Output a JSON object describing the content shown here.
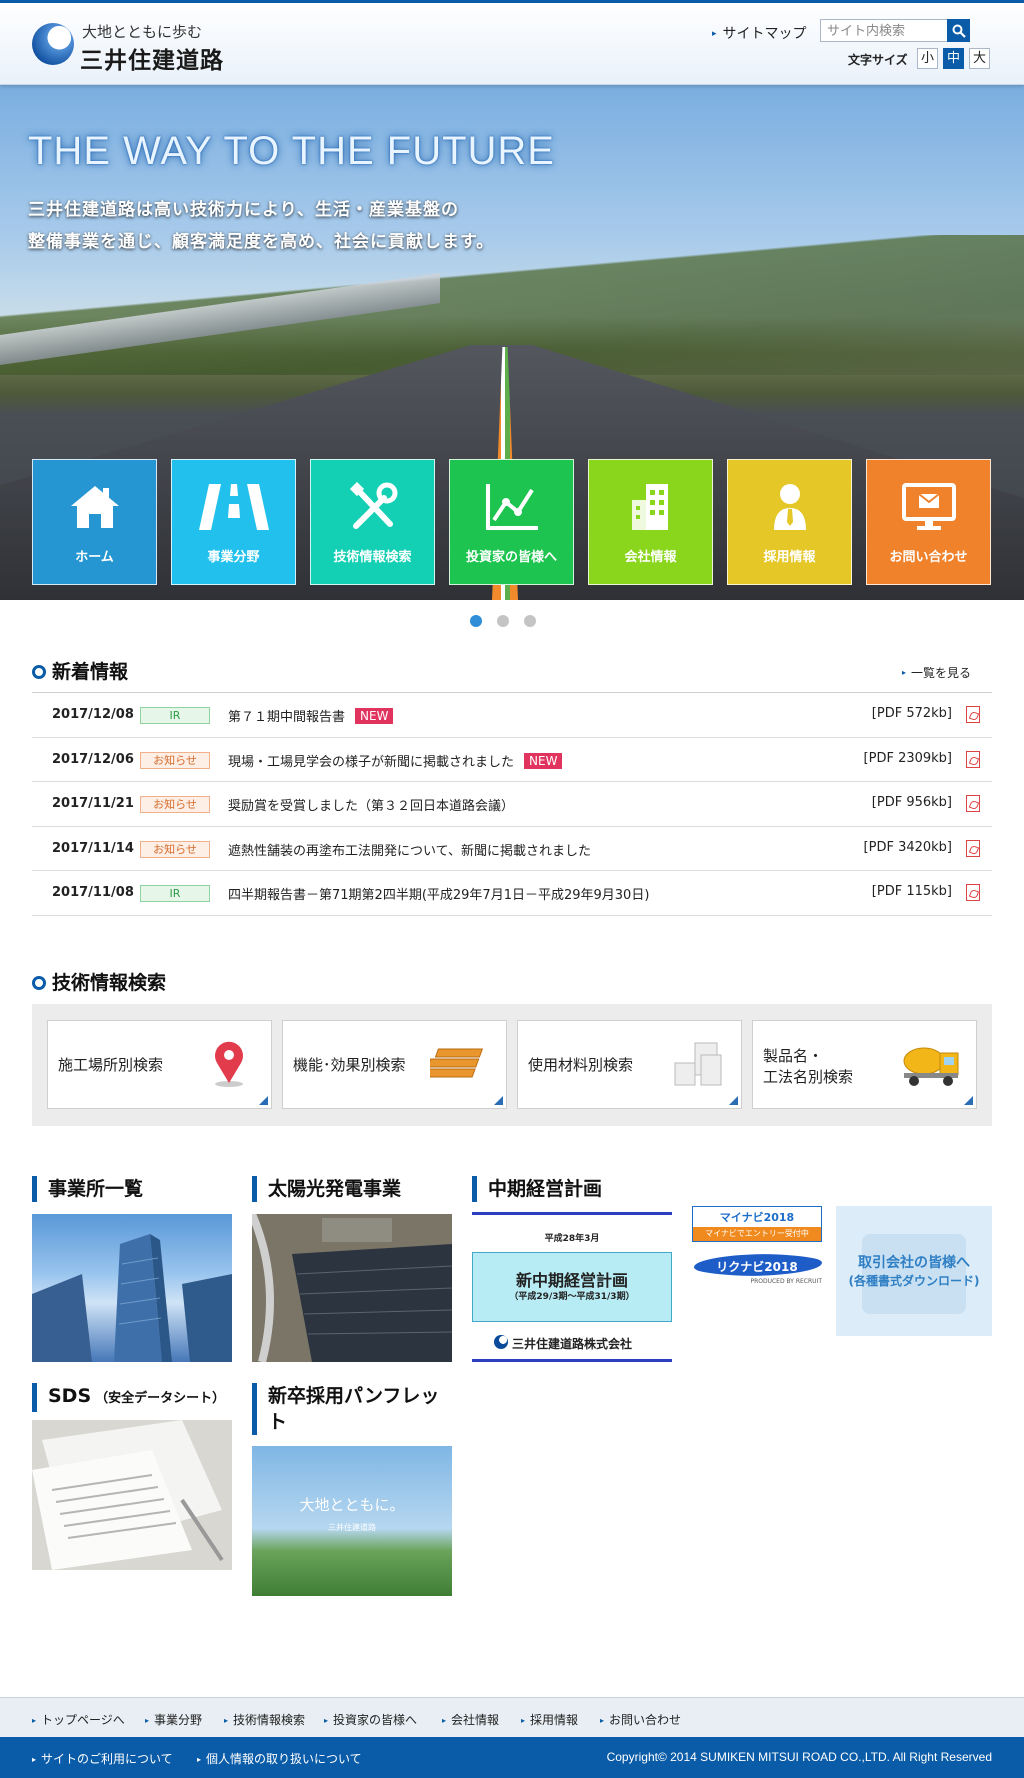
{
  "header": {
    "logo_tagline": "大地とともに歩む",
    "logo_name": "三井住建道路",
    "sitemap_label": "サイトマップ",
    "search_placeholder": "サイト内検索",
    "font_size_label": "文字サイズ",
    "font_sizes": [
      "小",
      "中",
      "大"
    ],
    "font_size_selected": "中"
  },
  "hero": {
    "title": "THE WAY TO THE FUTURE",
    "lines": [
      "三井住建道路は高い技術力により、生活・産業基盤の",
      "整備事業を通じ、顧客満足度を高め、社会に貢献します。"
    ],
    "slides_total": 3,
    "slide_active": 1
  },
  "tiles": [
    {
      "label": "ホーム",
      "icon": "house-icon",
      "color": "#2596d1"
    },
    {
      "label": "事業分野",
      "icon": "road-icon",
      "color": "#22c0ec"
    },
    {
      "label": "技術情報検索",
      "icon": "tools-icon",
      "color": "#13cfb3"
    },
    {
      "label": "投資家の皆様へ",
      "icon": "line-chart-icon",
      "color": "#1dc44f"
    },
    {
      "label": "会社情報",
      "icon": "building-icon",
      "color": "#8ad61c"
    },
    {
      "label": "採用情報",
      "icon": "person-icon",
      "color": "#e5c727"
    },
    {
      "label": "お問い合わせ",
      "icon": "mail-monitor-icon",
      "color": "#f0822c"
    }
  ],
  "news": {
    "heading": "新着情報",
    "more_label": "一覧を見る",
    "items": [
      {
        "date": "2017/12/08",
        "tag": "IR",
        "tag_type": "ir",
        "title": "第７１期中間報告書",
        "is_new": true,
        "new_label": "NEW",
        "size": "[PDF 572kb]"
      },
      {
        "date": "2017/12/06",
        "tag": "お知らせ",
        "tag_type": "info",
        "title": "現場・工場見学会の様子が新聞に掲載されました",
        "is_new": true,
        "new_label": "NEW",
        "size": "[PDF 2309kb]"
      },
      {
        "date": "2017/11/21",
        "tag": "お知らせ",
        "tag_type": "info",
        "title": "奨励賞を受賞しました（第３２回日本道路会議）",
        "is_new": false,
        "new_label": "",
        "size": "[PDF 956kb]"
      },
      {
        "date": "2017/11/14",
        "tag": "お知らせ",
        "tag_type": "info",
        "title": "遮熱性舗装の再塗布工法開発について、新聞に掲載されました",
        "is_new": false,
        "new_label": "",
        "size": "[PDF 3420kb]"
      },
      {
        "date": "2017/11/08",
        "tag": "IR",
        "tag_type": "ir",
        "title": "四半期報告書－第71期第2四半期(平成29年7月1日－平成29年9月30日)",
        "is_new": false,
        "new_label": "",
        "size": "[PDF 115kb]"
      }
    ]
  },
  "tech": {
    "heading": "技術情報検索",
    "cards": [
      {
        "label": "施工場所別検索",
        "icon": "map-pin-icon"
      },
      {
        "label": "機能･効果別検索",
        "icon": "layers-icon"
      },
      {
        "label": "使用材料別検索",
        "icon": "blocks-icon"
      },
      {
        "label": "製品名・\n工法名別検索",
        "icon": "mixer-truck-icon"
      }
    ]
  },
  "blocks": {
    "offices": "事業所一覧",
    "solar": "太陽光発電事業",
    "plan": "中期経営計画",
    "plan_banner": {
      "date": "平成28年3月",
      "title": "新中期経営計画",
      "period": "（平成29/3期～平成31/3期）",
      "company": "三井住建道路株式会社"
    },
    "mynavi": {
      "name": "マイナビ2018",
      "sub": "マイナビでエントリー受付中"
    },
    "rikunabi": {
      "name": "リクナビ2018",
      "sub": "PRODUCED BY RECRUIT"
    },
    "partners": {
      "line1": "取引会社の皆様へ",
      "line2": "(各種書式ダウンロード)"
    },
    "sds": "SDS",
    "sds_sub": "（安全データシート）",
    "pamphlet": "新卒採用パンフレット",
    "pamphlet_image": {
      "title": "大地とともに。",
      "company": "三井住建道路"
    }
  },
  "footer": {
    "nav": [
      "トップページへ",
      "事業分野",
      "技術情報検索",
      "投資家の皆様へ",
      "会社情報",
      "採用情報",
      "お問い合わせ"
    ],
    "links": [
      "サイトのご利用について",
      "個人情報の取り扱いについて"
    ],
    "copyright": "Copyright© 2014 SUMIKEN MITSUI ROAD CO.,LTD. All Right Reserved"
  }
}
